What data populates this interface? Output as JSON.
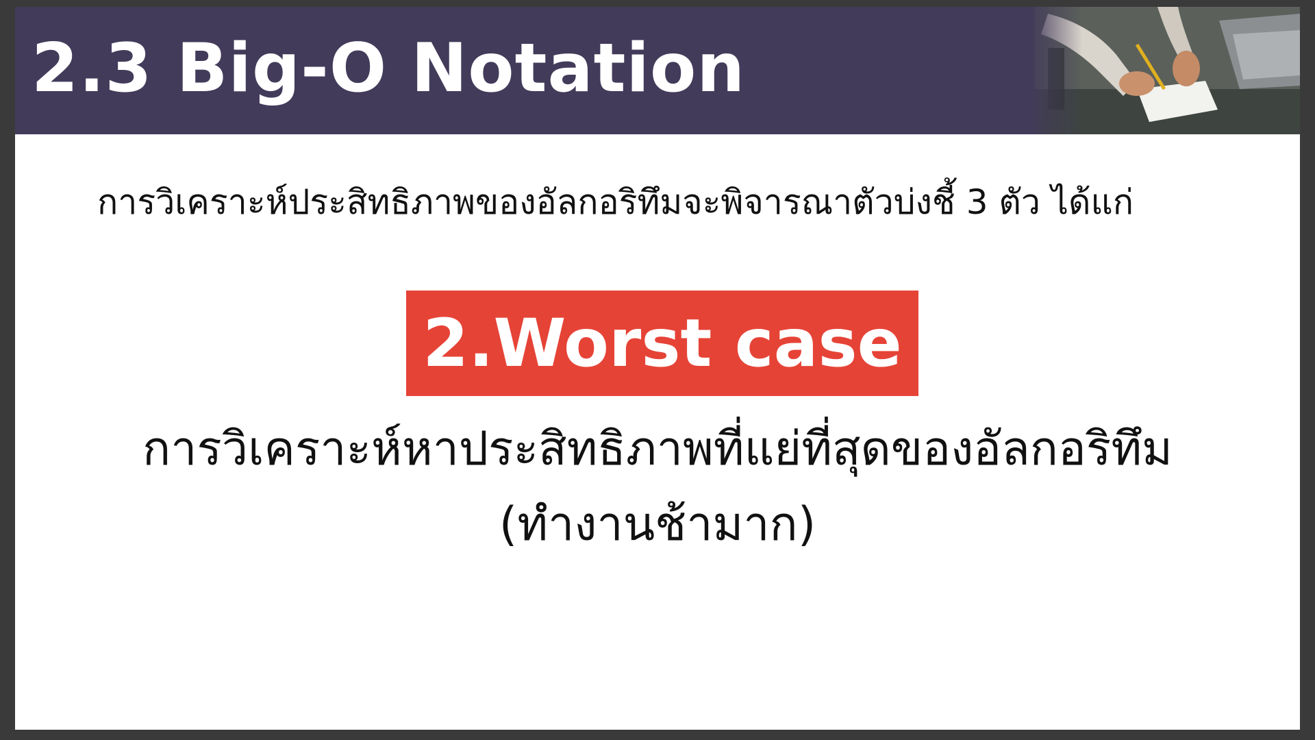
{
  "slide": {
    "title": "2.3 Big-O Notation",
    "subtitle": "การวิเคราะห์ประสิทธิภาพของอัลกอริทึมจะพิจารณาตัวบ่งชี้ 3 ตัว ได้แก่",
    "case_label": "2.Worst case",
    "description_line1": "การวิเคราะห์หาประสิทธิภาพที่แย่ที่สุดของอัลกอริทึม",
    "description_line2": "(ทำงานช้ามาก)"
  },
  "colors": {
    "header_bg": "#433b5a",
    "badge_bg": "#e64337",
    "slide_bg": "#ffffff",
    "frame_bg": "#3a3a3a"
  },
  "icons": {
    "header_photo": "person-writing-at-desk-photo"
  }
}
